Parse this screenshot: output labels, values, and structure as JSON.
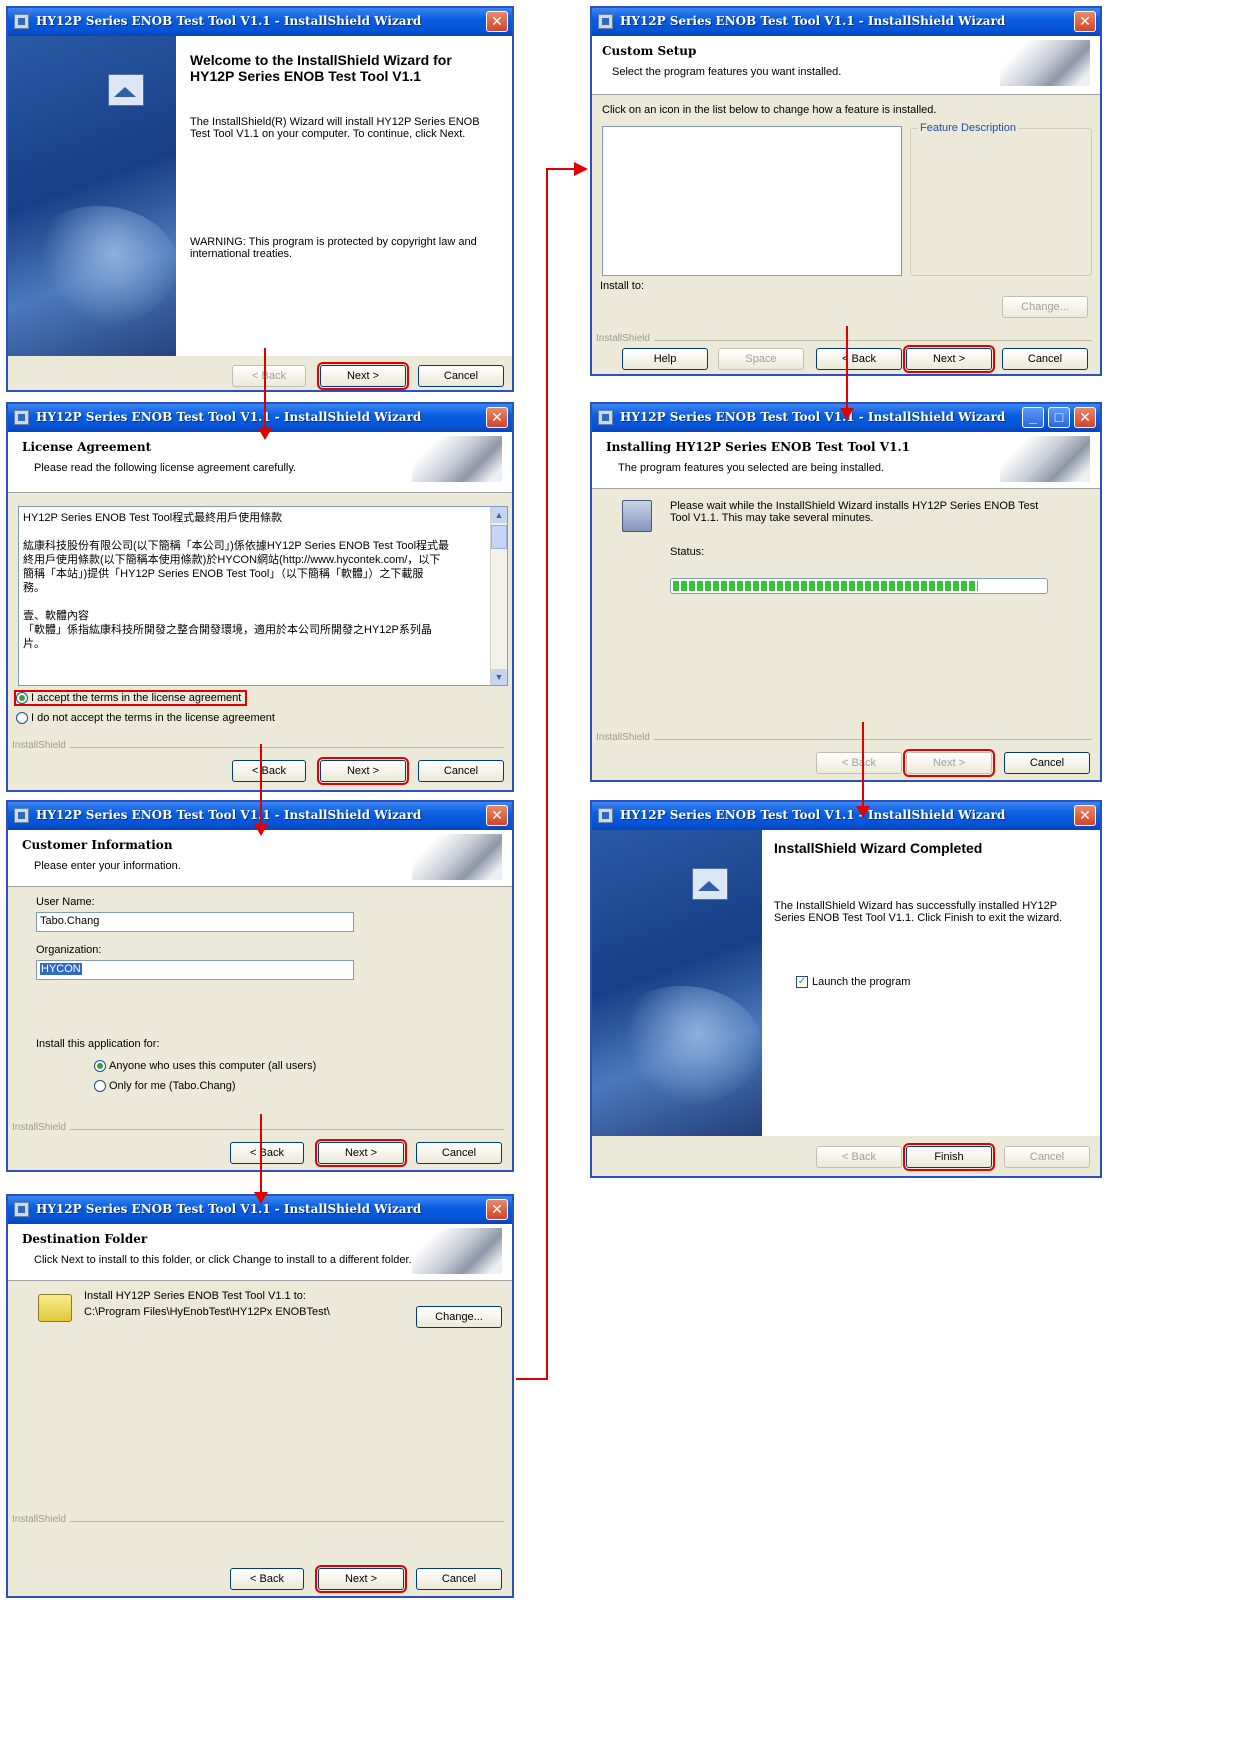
{
  "window_title": "HY12P Series ENOB Test Tool V1.1 - InstallShield Wizard",
  "installshield_label": "InstallShield",
  "buttons": {
    "back": "< Back",
    "next": "Next >",
    "cancel": "Cancel",
    "help": "Help",
    "space": "Space",
    "change": "Change...",
    "finish": "Finish"
  },
  "welcome": {
    "title": "Welcome to the InstallShield Wizard for HY12P Series ENOB Test Tool V1.1",
    "body": "The InstallShield(R) Wizard will install HY12P Series ENOB Test Tool V1.1 on your computer. To continue, click Next.",
    "warning": "WARNING: This program is protected by copyright law and international treaties."
  },
  "license": {
    "title": "License Agreement",
    "subtitle": "Please read the following license agreement carefully.",
    "text_lines": [
      "HY12P Series ENOB Test Tool程式最終用戶使用條款",
      "",
      "紘康科技股份有限公司(以下簡稱「本公司」)係依據HY12P Series ENOB Test Tool程式最",
      "終用戶使用條款(以下簡稱本使用條款)於HYCON網站(http://www.hycontek.com/，以下",
      "簡稱「本站」)提供「HY12P Series ENOB Test Tool」（以下簡稱「軟體」）之下載服",
      "務。",
      "",
      "壹、軟體內容",
      "「軟體」係指紘康科技所開發之整合開發環境，適用於本公司所開發之HY12P系列晶",
      "片。"
    ],
    "accept": "I accept the terms in the license agreement",
    "decline": "I do not accept the terms in the license agreement"
  },
  "customer": {
    "title": "Customer Information",
    "subtitle": "Please enter your information.",
    "user_label": "User Name:",
    "user_value": "Tabo.Chang",
    "org_label": "Organization:",
    "org_value": "HYCON",
    "install_for_label": "Install this application for:",
    "opt_all": "Anyone who uses this computer (all users)",
    "opt_me": "Only for me (Tabo.Chang)"
  },
  "destination": {
    "title": "Destination Folder",
    "subtitle": "Click Next to install to this folder, or click Change to install to a different folder.",
    "line1": "Install HY12P Series ENOB Test Tool V1.1 to:",
    "path": "C:\\Program Files\\HyEnobTest\\HY12Px ENOBTest\\"
  },
  "custom_setup": {
    "title": "Custom Setup",
    "subtitle": "Select the program features you want installed.",
    "instruction": "Click on an icon in the list below to change how a feature is installed.",
    "feature_desc": "Feature Description",
    "install_to": "Install to:"
  },
  "installing": {
    "title": "Installing HY12P Series ENOB Test Tool V1.1",
    "subtitle": "The program features you selected are being installed.",
    "wait_text": "Please wait while the InstallShield Wizard installs HY12P Series ENOB Test Tool V1.1. This may take several minutes.",
    "status_label": "Status:",
    "progress": 0.82
  },
  "completed": {
    "title": "InstallShield Wizard Completed",
    "body": "The InstallShield Wizard has successfully installed HY12P Series ENOB Test Tool V1.1. Click Finish to exit the wizard.",
    "launch": "Launch the program"
  },
  "colors": {
    "highlight": "#e00000",
    "titlebar": "#0553d6",
    "dialog_bg": "#ece9d8"
  }
}
